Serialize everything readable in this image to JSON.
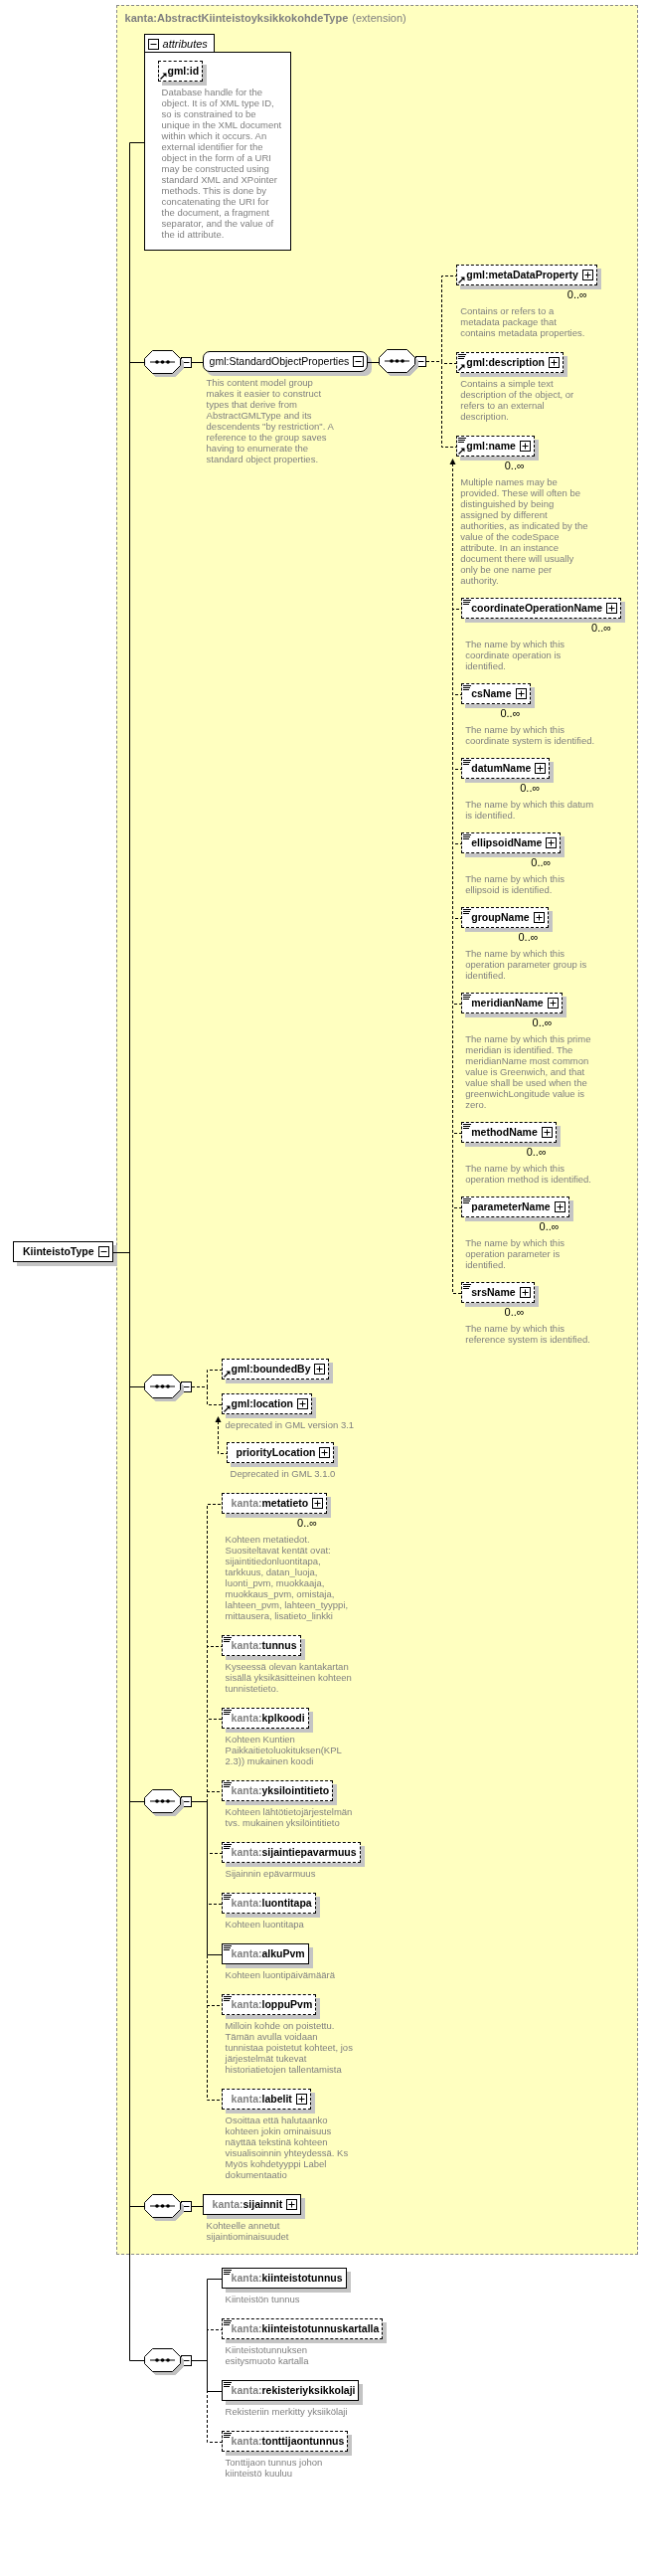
{
  "root": {
    "kind": "element",
    "name": "KiinteistoType",
    "optional": false,
    "reference": false,
    "text_content": false,
    "expanded": true,
    "extension": {
      "base": "kanta:AbstractKiinteistoyksikkokohdeType",
      "derivation": "(extension)",
      "items": [
        {
          "kind": "attributes",
          "label": "attributes",
          "expanded": true,
          "attributes": [
            {
              "kind": "element",
              "name": "gml:id",
              "optional": true,
              "reference": true,
              "text_content": false,
              "doc": "Database handle for the object. It is of XML type ID, so is constrained to be unique in the XML document within which it occurs. An external identifier for the object in the form of a URI may be constructed using standard XML and XPointer methods. This is done by concatenating the URI for the document, a fragment separator, and the value of the id attribute."
            }
          ]
        },
        {
          "kind": "sequence",
          "expanded": true,
          "children": [
            {
              "kind": "group",
              "name": "gml:StandardObjectProperties",
              "optional": false,
              "reference": false,
              "text_content": false,
              "expanded": true,
              "doc": "This content model group makes it easier to construct types that derive from AbstractGMLType and its descendents \"by restriction\". A reference to the group saves having to enumerate the standard object properties.",
              "children": [
                {
                  "kind": "sequence",
                  "expanded": true,
                  "children": [
                    {
                      "kind": "element",
                      "name": "gml:metaDataProperty",
                      "optional": true,
                      "reference": true,
                      "text_content": false,
                      "expanded": false,
                      "occurs": "0..∞",
                      "doc": "Contains or refers to a metadata package that contains metadata properties."
                    },
                    {
                      "kind": "element",
                      "name": "gml:description",
                      "optional": true,
                      "reference": true,
                      "text_content": true,
                      "expanded": false,
                      "doc": "Contains a simple text description of the object, or refers to an external description."
                    },
                    {
                      "kind": "element",
                      "name": "gml:name",
                      "optional": true,
                      "reference": true,
                      "text_content": true,
                      "expanded": false,
                      "occurs": "0..∞",
                      "doc": "Multiple names may be provided. These will often be distinguished by being assigned by different authorities, as indicated by the value of the codeSpace attribute. In an instance document there will usually only be one name per authority.",
                      "substitutes": [
                        {
                          "kind": "element",
                          "name": "coordinateOperationName",
                          "optional": true,
                          "reference": false,
                          "text_content": true,
                          "expanded": false,
                          "occurs": "0..∞",
                          "doc": "The name by which this coordinate operation is identified."
                        },
                        {
                          "kind": "element",
                          "name": "csName",
                          "optional": true,
                          "reference": false,
                          "text_content": true,
                          "expanded": false,
                          "occurs": "0..∞",
                          "doc": "The name by which this coordinate system is identified."
                        },
                        {
                          "kind": "element",
                          "name": "datumName",
                          "optional": true,
                          "reference": false,
                          "text_content": true,
                          "expanded": false,
                          "occurs": "0..∞",
                          "doc": "The name by which this datum is identified."
                        },
                        {
                          "kind": "element",
                          "name": "ellipsoidName",
                          "optional": true,
                          "reference": false,
                          "text_content": true,
                          "expanded": false,
                          "occurs": "0..∞",
                          "doc": "The name by which this ellipsoid is identified."
                        },
                        {
                          "kind": "element",
                          "name": "groupName",
                          "optional": true,
                          "reference": false,
                          "text_content": true,
                          "expanded": false,
                          "occurs": "0..∞",
                          "doc": "The name by which this operation parameter group is identified."
                        },
                        {
                          "kind": "element",
                          "name": "meridianName",
                          "optional": true,
                          "reference": false,
                          "text_content": true,
                          "expanded": false,
                          "occurs": "0..∞",
                          "doc": "The name by which this prime meridian is identified. The meridianName most common value is Greenwich, and that value shall be used when the greenwichLongitude value is zero."
                        },
                        {
                          "kind": "element",
                          "name": "methodName",
                          "optional": true,
                          "reference": false,
                          "text_content": true,
                          "expanded": false,
                          "occurs": "0..∞",
                          "doc": "The name by which this operation method is identified."
                        },
                        {
                          "kind": "element",
                          "name": "parameterName",
                          "optional": true,
                          "reference": false,
                          "text_content": true,
                          "expanded": false,
                          "occurs": "0..∞",
                          "doc": "The name by which this operation parameter is identified."
                        },
                        {
                          "kind": "element",
                          "name": "srsName",
                          "optional": true,
                          "reference": false,
                          "text_content": true,
                          "expanded": false,
                          "occurs": "0..∞",
                          "doc": "The name by which this reference system is identified."
                        }
                      ]
                    }
                  ]
                }
              ]
            }
          ]
        },
        {
          "kind": "sequence",
          "expanded": true,
          "children": [
            {
              "kind": "element",
              "name": "gml:boundedBy",
              "optional": true,
              "reference": true,
              "text_content": false,
              "expanded": false
            },
            {
              "kind": "element",
              "name": "gml:location",
              "optional": true,
              "reference": true,
              "text_content": false,
              "expanded": false,
              "doc": "deprecated in GML version 3.1",
              "substitutes": [
                {
                  "kind": "element",
                  "name": "priorityLocation",
                  "optional": true,
                  "reference": false,
                  "text_content": false,
                  "expanded": false,
                  "doc": "Deprecated in GML 3.1.0"
                }
              ]
            }
          ]
        },
        {
          "kind": "sequence",
          "expanded": true,
          "children": [
            {
              "kind": "element",
              "prefix": "kanta:",
              "name": "metatieto",
              "optional": true,
              "reference": false,
              "text_content": false,
              "expanded": false,
              "occurs": "0..∞",
              "doc": "Kohteen metatiedot. Suositeltavat kentät ovat: sijaintitiedonluontitapa, tarkkuus, datan_luoja, luonti_pvm, muokkaaja, muokkaus_pvm, omistaja, lahteen_pvm, lahteen_tyyppi, mittausera, lisatieto_linkki"
            },
            {
              "kind": "element",
              "prefix": "kanta:",
              "name": "tunnus",
              "optional": true,
              "reference": false,
              "text_content": true,
              "doc": "Kyseessä olevan kantakartan sisällä yksikäsitteinen kohteen tunnistetieto."
            },
            {
              "kind": "element",
              "prefix": "kanta:",
              "name": "kplkoodi",
              "optional": true,
              "reference": false,
              "text_content": true,
              "doc": "Kohteen Kuntien Paikkaitietoluokituksen(KPL 2.3)) mukainen koodi"
            },
            {
              "kind": "element",
              "prefix": "kanta:",
              "name": "yksilointitieto",
              "optional": true,
              "reference": false,
              "text_content": true,
              "doc": "Kohteen lähtötietojärjestelmän tvs. mukainen yksilöintitieto"
            },
            {
              "kind": "element",
              "prefix": "kanta:",
              "name": "sijaintiepavarmuus",
              "optional": true,
              "reference": false,
              "text_content": true,
              "doc": "Sijainnin epävarmuus"
            },
            {
              "kind": "element",
              "prefix": "kanta:",
              "name": "luontitapa",
              "optional": true,
              "reference": false,
              "text_content": true,
              "doc": "Kohteen luontitapa"
            },
            {
              "kind": "element",
              "prefix": "kanta:",
              "name": "alkuPvm",
              "optional": false,
              "reference": false,
              "text_content": true,
              "doc": "Kohteen luontipäivämäärä"
            },
            {
              "kind": "element",
              "prefix": "kanta:",
              "name": "loppuPvm",
              "optional": true,
              "reference": false,
              "text_content": true,
              "doc": "Milloin kohde on poistettu. Tämän avulla voidaan tunnistaa poistetut kohteet, jos järjestelmät tukevat historiatietojen tallentamista"
            },
            {
              "kind": "element",
              "prefix": "kanta:",
              "name": "labelit",
              "optional": true,
              "reference": false,
              "text_content": false,
              "expanded": false,
              "doc": "Osoittaa että halutaanko kohteen jokin ominaisuus näyttää tekstinä kohteen visualisoinnin yhteydessä. Ks Myös kohdetyyppi Label dokumentaatio"
            }
          ]
        },
        {
          "kind": "sequence",
          "expanded": true,
          "children": [
            {
              "kind": "element",
              "prefix": "kanta:",
              "name": "sijainnit",
              "optional": false,
              "reference": false,
              "text_content": false,
              "expanded": false,
              "doc": "Kohteelle annetut sijaintiominaisuudet"
            }
          ]
        }
      ]
    },
    "children": [
      {
        "kind": "sequence",
        "expanded": true,
        "children": [
          {
            "kind": "element",
            "prefix": "kanta:",
            "name": "kiinteistotunnus",
            "optional": false,
            "reference": false,
            "text_content": true,
            "doc": "Kiinteistön tunnus"
          },
          {
            "kind": "element",
            "prefix": "kanta:",
            "name": "kiinteistotunnuskartalla",
            "optional": true,
            "reference": false,
            "text_content": true,
            "doc": "Kiinteistotunnuksen esitysmuoto kartalla"
          },
          {
            "kind": "element",
            "prefix": "kanta:",
            "name": "rekisteriyksikkolaji",
            "optional": false,
            "reference": false,
            "text_content": true,
            "doc": "Rekisteriin merkitty yksiikölaji"
          },
          {
            "kind": "element",
            "prefix": "kanta:",
            "name": "tonttijaontunnus",
            "optional": true,
            "reference": false,
            "text_content": true,
            "doc": "Tonttijaon tunnus johon kiinteistö kuuluu"
          }
        ]
      }
    ]
  }
}
